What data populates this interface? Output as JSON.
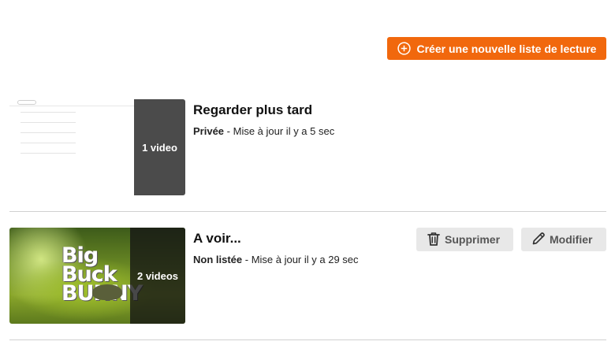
{
  "header": {
    "create_button_label": "Créer une nouvelle liste de lecture"
  },
  "playlists": [
    {
      "title": "Regarder plus tard",
      "privacy": "Privée",
      "separator": " - ",
      "updated": "Mise à jour il y a 5 sec",
      "video_count_label": "1 video",
      "thumbnail": "screenshot-preview"
    },
    {
      "title": "A voir...",
      "privacy": "Non listée",
      "separator": " - ",
      "updated": "Mise à jour il y a 29 sec",
      "video_count_label": "2 videos",
      "thumbnail": "big-buck-bunny",
      "thumbnail_text": "Big Buck BUNNY",
      "actions": {
        "delete_label": "Supprimer",
        "edit_label": "Modifier"
      }
    }
  ],
  "icons": {
    "create": "plus-circle-icon",
    "delete": "trash-icon",
    "edit": "pencil-icon"
  },
  "colors": {
    "accent": "#f1680d",
    "action_bg": "#e8e8e8",
    "divider": "#d0d0d0"
  }
}
